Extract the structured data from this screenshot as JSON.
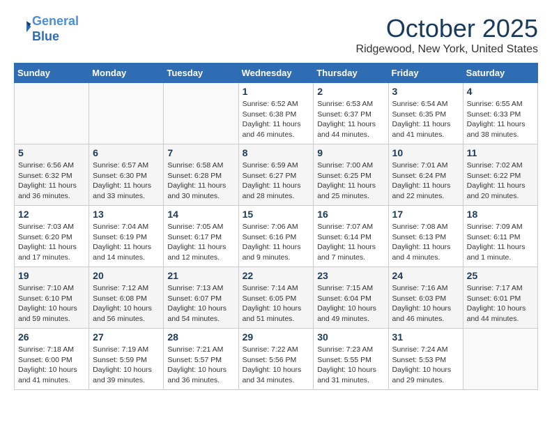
{
  "header": {
    "logo_line1": "General",
    "logo_line2": "Blue",
    "month": "October 2025",
    "location": "Ridgewood, New York, United States"
  },
  "weekdays": [
    "Sunday",
    "Monday",
    "Tuesday",
    "Wednesday",
    "Thursday",
    "Friday",
    "Saturday"
  ],
  "weeks": [
    [
      {
        "day": "",
        "info": ""
      },
      {
        "day": "",
        "info": ""
      },
      {
        "day": "",
        "info": ""
      },
      {
        "day": "1",
        "info": "Sunrise: 6:52 AM\nSunset: 6:38 PM\nDaylight: 11 hours\nand 46 minutes."
      },
      {
        "day": "2",
        "info": "Sunrise: 6:53 AM\nSunset: 6:37 PM\nDaylight: 11 hours\nand 44 minutes."
      },
      {
        "day": "3",
        "info": "Sunrise: 6:54 AM\nSunset: 6:35 PM\nDaylight: 11 hours\nand 41 minutes."
      },
      {
        "day": "4",
        "info": "Sunrise: 6:55 AM\nSunset: 6:33 PM\nDaylight: 11 hours\nand 38 minutes."
      }
    ],
    [
      {
        "day": "5",
        "info": "Sunrise: 6:56 AM\nSunset: 6:32 PM\nDaylight: 11 hours\nand 36 minutes."
      },
      {
        "day": "6",
        "info": "Sunrise: 6:57 AM\nSunset: 6:30 PM\nDaylight: 11 hours\nand 33 minutes."
      },
      {
        "day": "7",
        "info": "Sunrise: 6:58 AM\nSunset: 6:28 PM\nDaylight: 11 hours\nand 30 minutes."
      },
      {
        "day": "8",
        "info": "Sunrise: 6:59 AM\nSunset: 6:27 PM\nDaylight: 11 hours\nand 28 minutes."
      },
      {
        "day": "9",
        "info": "Sunrise: 7:00 AM\nSunset: 6:25 PM\nDaylight: 11 hours\nand 25 minutes."
      },
      {
        "day": "10",
        "info": "Sunrise: 7:01 AM\nSunset: 6:24 PM\nDaylight: 11 hours\nand 22 minutes."
      },
      {
        "day": "11",
        "info": "Sunrise: 7:02 AM\nSunset: 6:22 PM\nDaylight: 11 hours\nand 20 minutes."
      }
    ],
    [
      {
        "day": "12",
        "info": "Sunrise: 7:03 AM\nSunset: 6:20 PM\nDaylight: 11 hours\nand 17 minutes."
      },
      {
        "day": "13",
        "info": "Sunrise: 7:04 AM\nSunset: 6:19 PM\nDaylight: 11 hours\nand 14 minutes."
      },
      {
        "day": "14",
        "info": "Sunrise: 7:05 AM\nSunset: 6:17 PM\nDaylight: 11 hours\nand 12 minutes."
      },
      {
        "day": "15",
        "info": "Sunrise: 7:06 AM\nSunset: 6:16 PM\nDaylight: 11 hours\nand 9 minutes."
      },
      {
        "day": "16",
        "info": "Sunrise: 7:07 AM\nSunset: 6:14 PM\nDaylight: 11 hours\nand 7 minutes."
      },
      {
        "day": "17",
        "info": "Sunrise: 7:08 AM\nSunset: 6:13 PM\nDaylight: 11 hours\nand 4 minutes."
      },
      {
        "day": "18",
        "info": "Sunrise: 7:09 AM\nSunset: 6:11 PM\nDaylight: 11 hours\nand 1 minute."
      }
    ],
    [
      {
        "day": "19",
        "info": "Sunrise: 7:10 AM\nSunset: 6:10 PM\nDaylight: 10 hours\nand 59 minutes."
      },
      {
        "day": "20",
        "info": "Sunrise: 7:12 AM\nSunset: 6:08 PM\nDaylight: 10 hours\nand 56 minutes."
      },
      {
        "day": "21",
        "info": "Sunrise: 7:13 AM\nSunset: 6:07 PM\nDaylight: 10 hours\nand 54 minutes."
      },
      {
        "day": "22",
        "info": "Sunrise: 7:14 AM\nSunset: 6:05 PM\nDaylight: 10 hours\nand 51 minutes."
      },
      {
        "day": "23",
        "info": "Sunrise: 7:15 AM\nSunset: 6:04 PM\nDaylight: 10 hours\nand 49 minutes."
      },
      {
        "day": "24",
        "info": "Sunrise: 7:16 AM\nSunset: 6:03 PM\nDaylight: 10 hours\nand 46 minutes."
      },
      {
        "day": "25",
        "info": "Sunrise: 7:17 AM\nSunset: 6:01 PM\nDaylight: 10 hours\nand 44 minutes."
      }
    ],
    [
      {
        "day": "26",
        "info": "Sunrise: 7:18 AM\nSunset: 6:00 PM\nDaylight: 10 hours\nand 41 minutes."
      },
      {
        "day": "27",
        "info": "Sunrise: 7:19 AM\nSunset: 5:59 PM\nDaylight: 10 hours\nand 39 minutes."
      },
      {
        "day": "28",
        "info": "Sunrise: 7:21 AM\nSunset: 5:57 PM\nDaylight: 10 hours\nand 36 minutes."
      },
      {
        "day": "29",
        "info": "Sunrise: 7:22 AM\nSunset: 5:56 PM\nDaylight: 10 hours\nand 34 minutes."
      },
      {
        "day": "30",
        "info": "Sunrise: 7:23 AM\nSunset: 5:55 PM\nDaylight: 10 hours\nand 31 minutes."
      },
      {
        "day": "31",
        "info": "Sunrise: 7:24 AM\nSunset: 5:53 PM\nDaylight: 10 hours\nand 29 minutes."
      },
      {
        "day": "",
        "info": ""
      }
    ]
  ]
}
